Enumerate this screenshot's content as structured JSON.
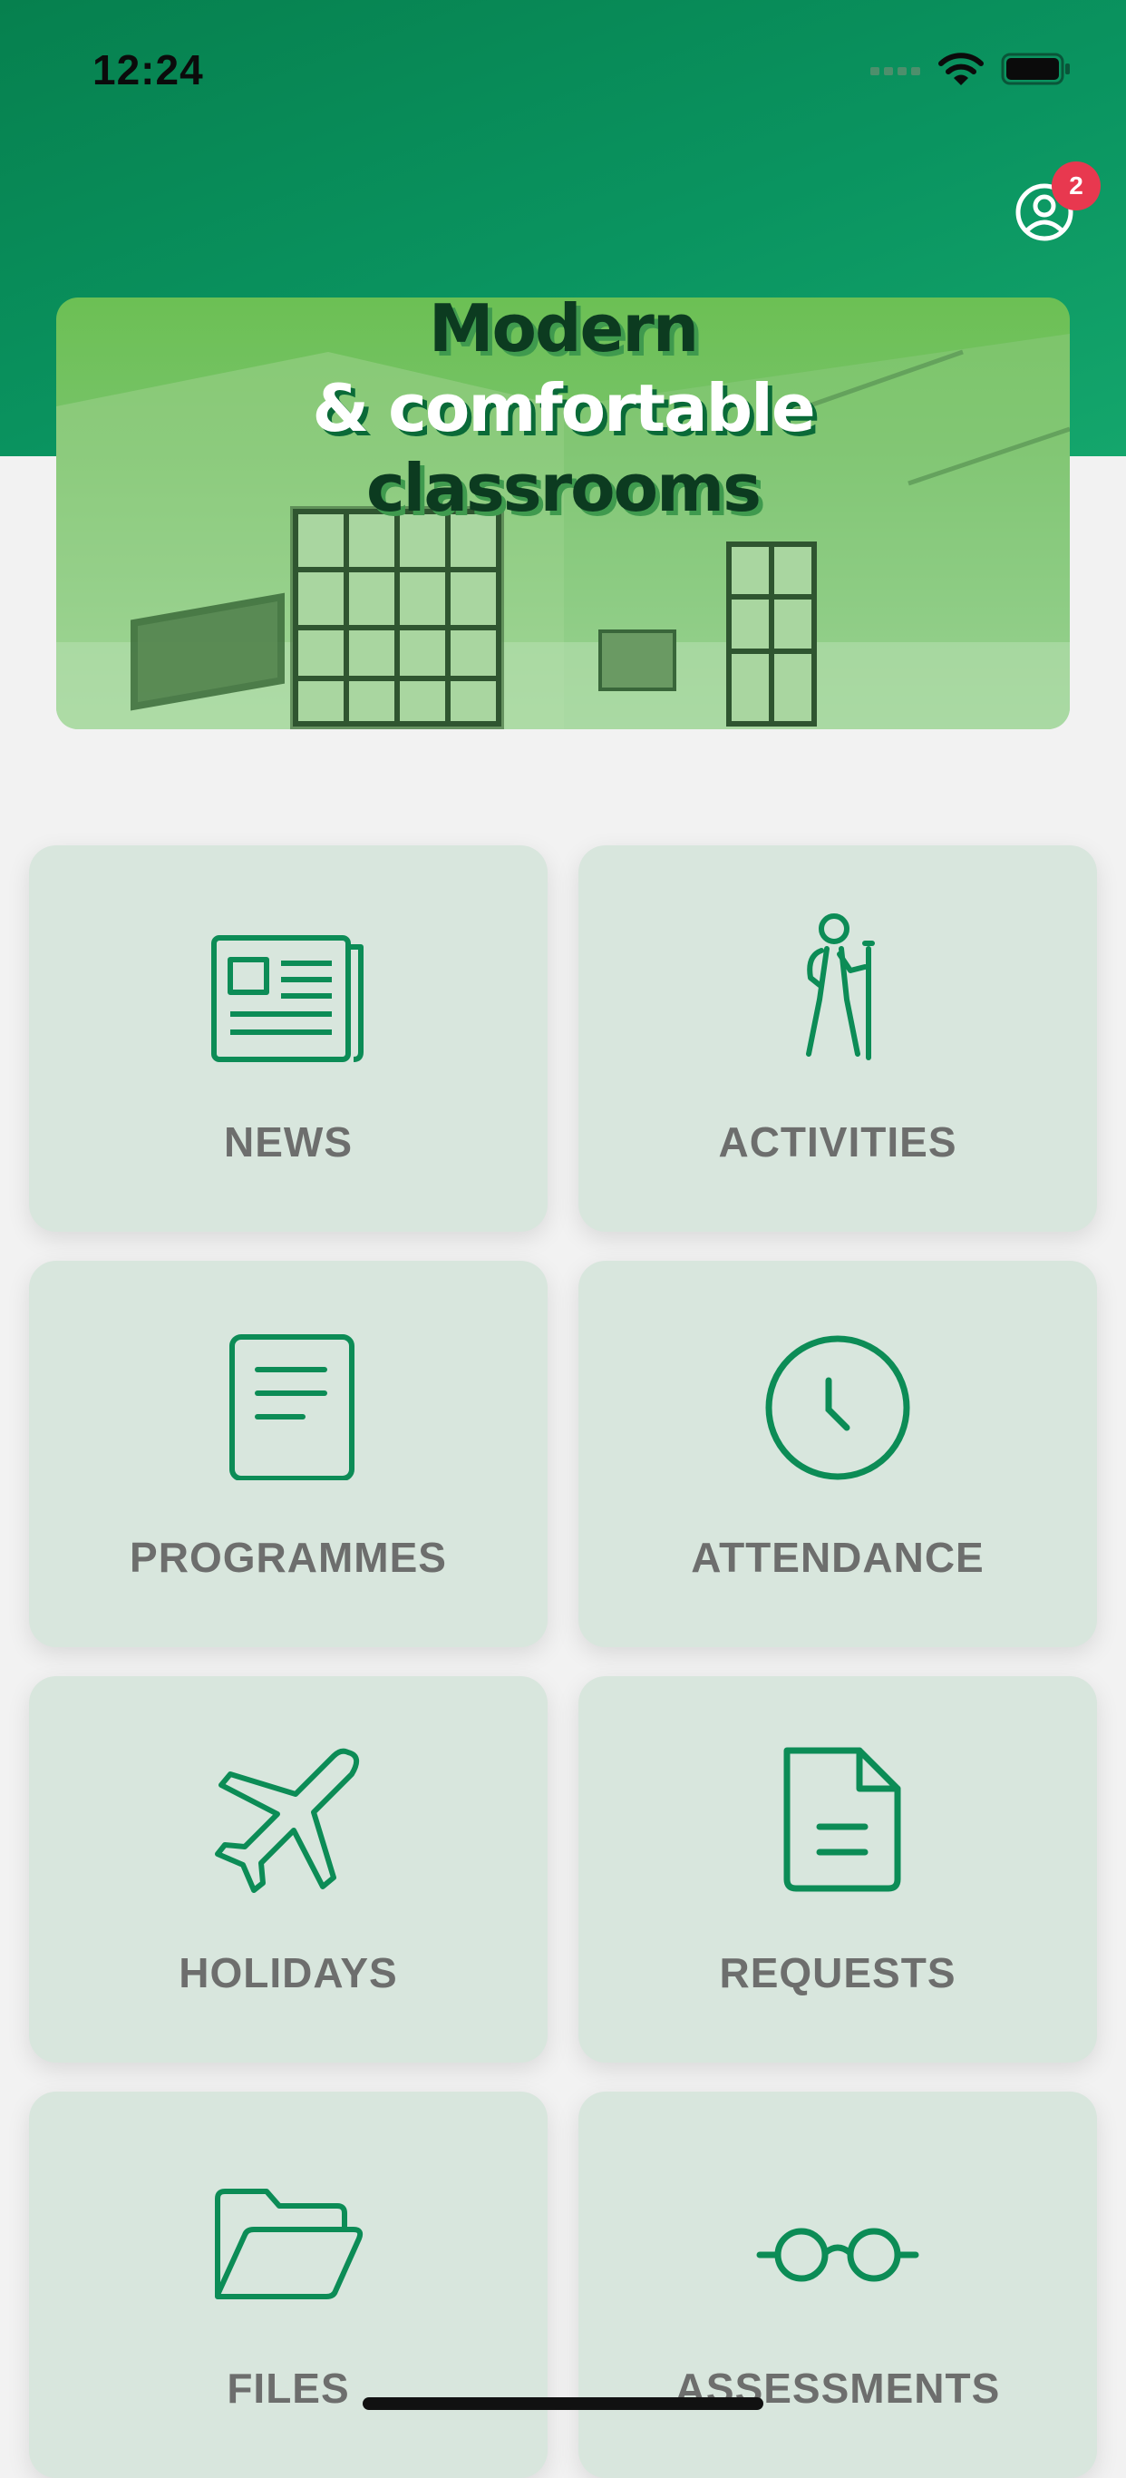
{
  "status_bar": {
    "time": "12:24"
  },
  "header": {
    "notification_count": "2"
  },
  "banner": {
    "line1": "Modern",
    "line2": "& comfortable",
    "line3": "classrooms"
  },
  "tiles": [
    {
      "label": "NEWS",
      "icon": "newspaper-icon"
    },
    {
      "label": "ACTIVITIES",
      "icon": "hiker-icon"
    },
    {
      "label": "PROGRAMMES",
      "icon": "document-list-icon"
    },
    {
      "label": "ATTENDANCE",
      "icon": "clock-icon"
    },
    {
      "label": "HOLIDAYS",
      "icon": "airplane-icon"
    },
    {
      "label": "REQUESTS",
      "icon": "file-icon"
    },
    {
      "label": "FILES",
      "icon": "folder-open-icon"
    },
    {
      "label": "ASSESSMENTS",
      "icon": "glasses-icon"
    }
  ],
  "colors": {
    "brand_green": "#0a8a55",
    "badge_red": "#e8384f",
    "tile_bg": "#d8e6dd"
  }
}
